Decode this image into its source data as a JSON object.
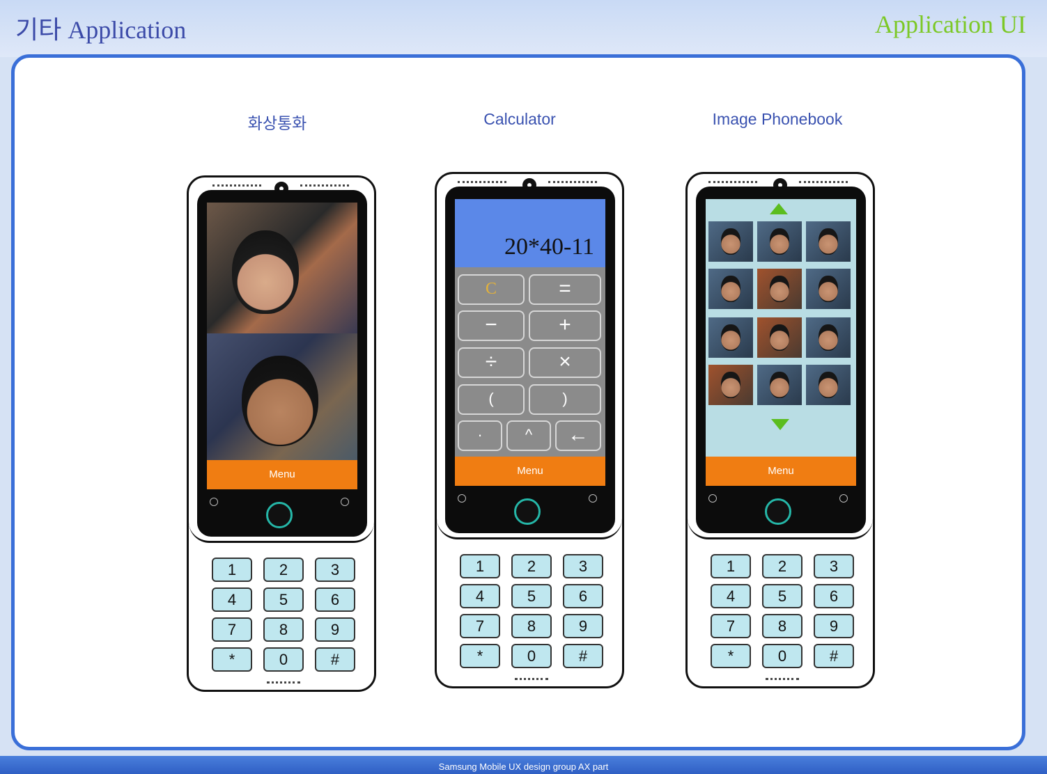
{
  "header": {
    "title": "기타 Application",
    "section": "Application UI"
  },
  "footer": {
    "text": "Samsung Mobile UX design group AX part"
  },
  "apps": [
    {
      "caption": "화상통화",
      "menu_label": "Menu"
    },
    {
      "caption": "Calculator",
      "menu_label": "Menu",
      "display": "20*40-11",
      "keys": [
        "C",
        "=",
        "−",
        "+",
        "÷",
        "×",
        "(",
        ")",
        "·",
        "^",
        "←"
      ]
    },
    {
      "caption": "Image Phonebook",
      "menu_label": "Menu"
    }
  ],
  "keypad": [
    "1",
    "2",
    "3",
    "4",
    "5",
    "6",
    "7",
    "8",
    "9",
    "*",
    "0",
    "#"
  ],
  "colors": {
    "accent_blue": "#3a6fd8",
    "menu_orange": "#f07d12",
    "title_green": "#7cc826",
    "home_ring": "#25b7a8"
  }
}
